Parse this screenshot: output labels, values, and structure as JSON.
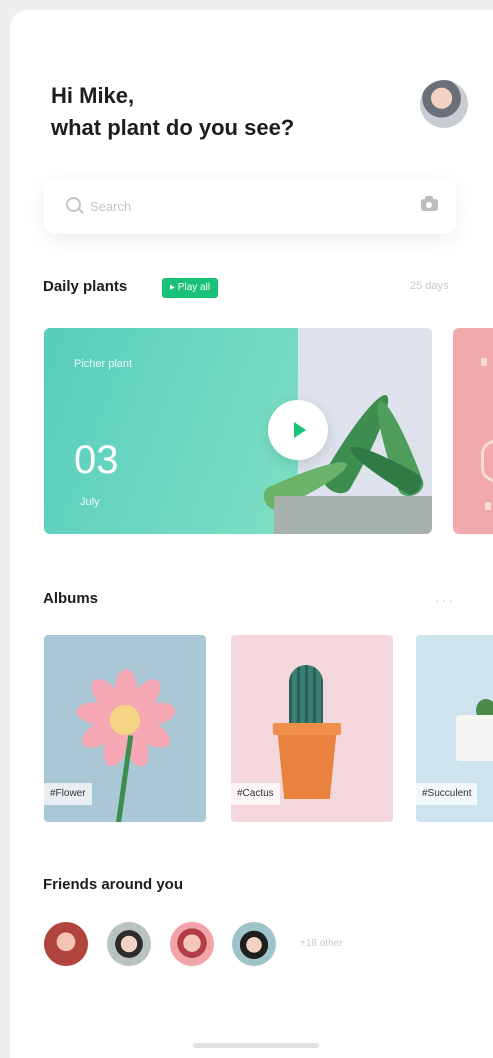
{
  "header": {
    "greeting_line1": "Hi Mike,",
    "greeting_line2": "what plant do you see?",
    "avatar_icon": "user-avatar"
  },
  "search": {
    "placeholder": "Search",
    "search_icon": "search-icon",
    "camera_icon": "camera-icon"
  },
  "daily": {
    "title": "Daily plants",
    "play_all_label": "▸ Play all",
    "days_label": "25 days",
    "cards": [
      {
        "name": "Picher plant",
        "day": "03",
        "month": "July",
        "color": "#5fd0bc"
      },
      {
        "color": "#f1a9ab"
      }
    ]
  },
  "albums": {
    "title": "Albums",
    "more_label": "···",
    "items": [
      {
        "tag": "#Flower",
        "color": "#a9c7d4"
      },
      {
        "tag": "#Cactus",
        "color": "#f3d7dc"
      },
      {
        "tag": "#Succulent",
        "color": "#cde3ee"
      }
    ]
  },
  "friends": {
    "title": "Friends around you",
    "others_label": "+18 other"
  },
  "colors": {
    "accent": "#19c279",
    "text": "#1d1d1d",
    "muted": "#c8c8c8"
  }
}
